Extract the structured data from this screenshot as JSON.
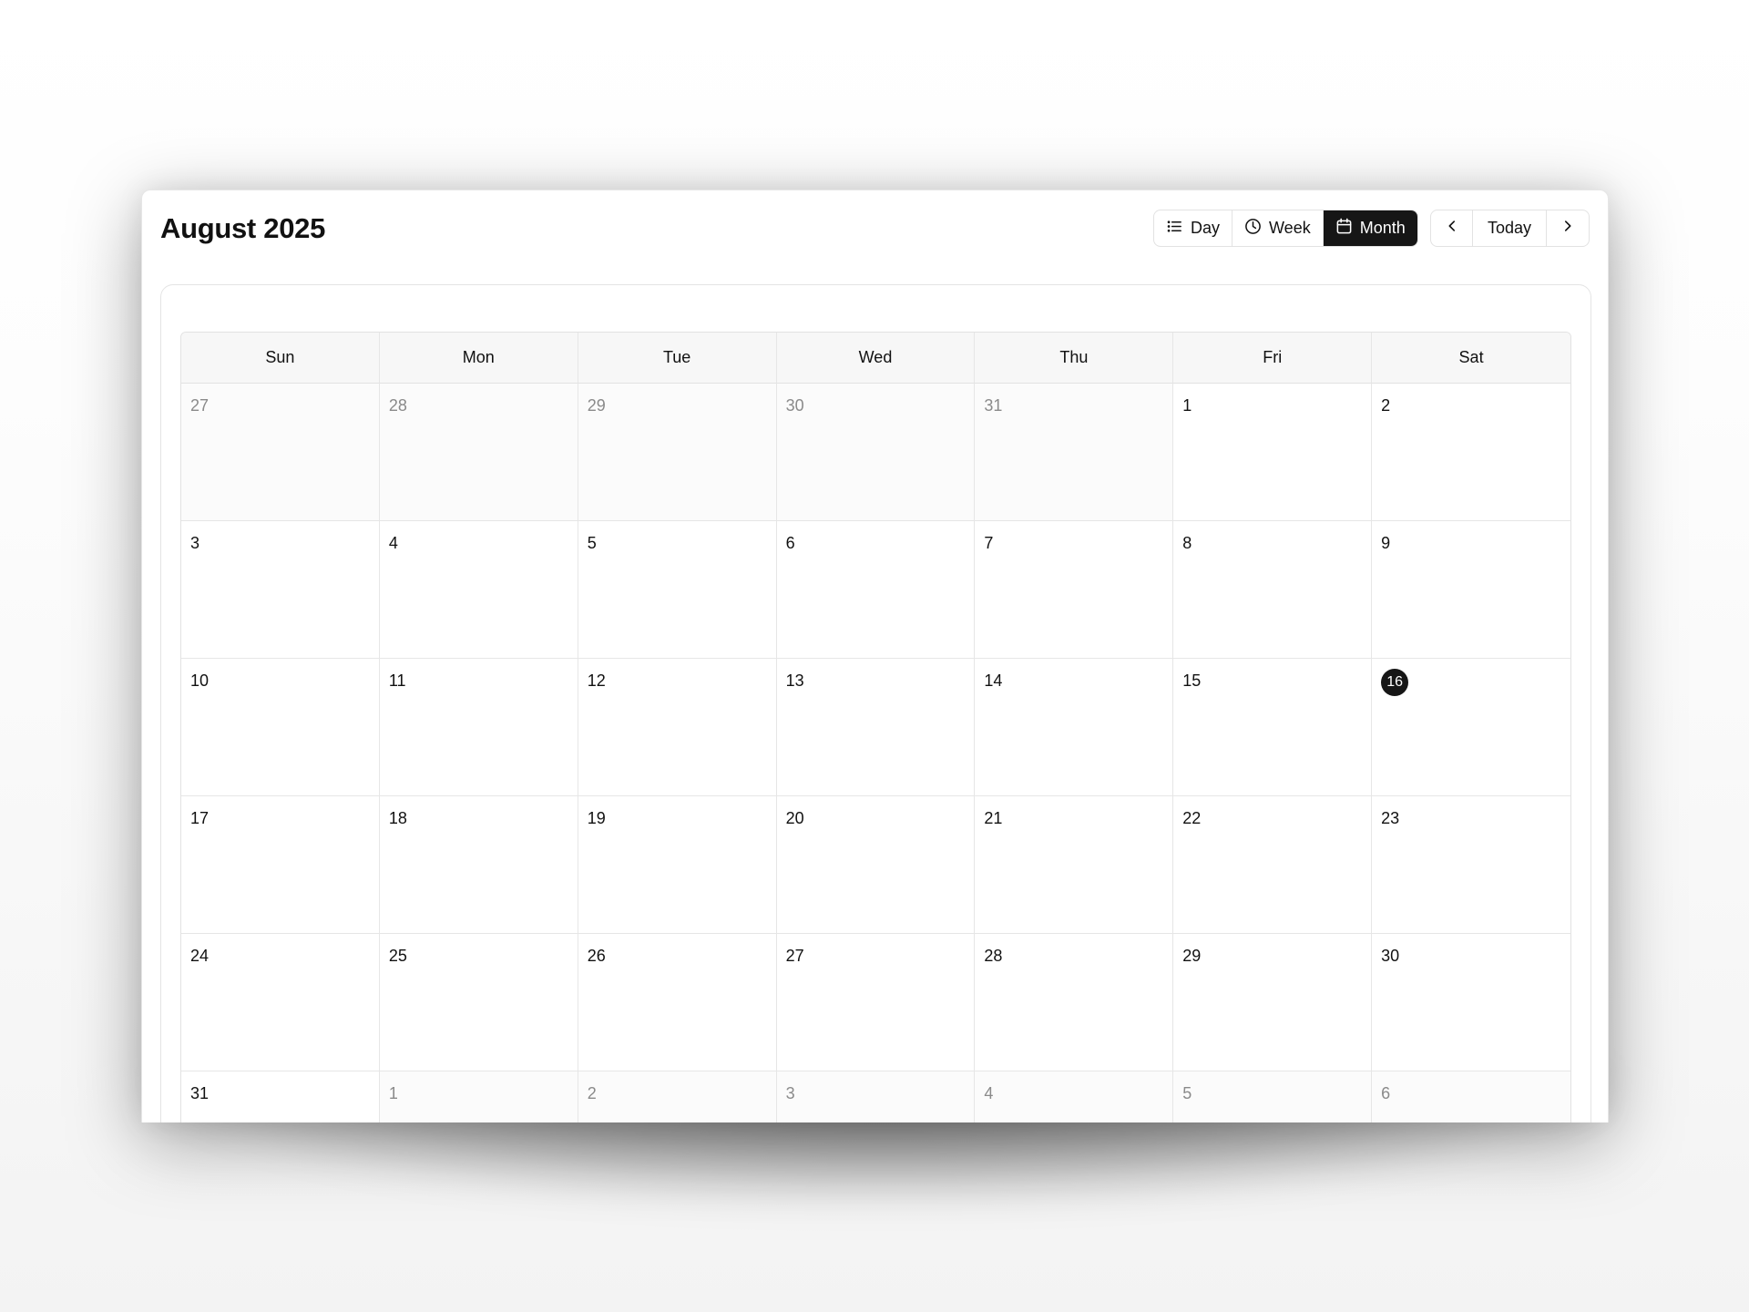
{
  "header": {
    "title": "August 2025",
    "views": [
      {
        "label": "Day",
        "icon": "list-icon",
        "active": false
      },
      {
        "label": "Week",
        "icon": "clock-icon",
        "active": false
      },
      {
        "label": "Month",
        "icon": "calendar-icon",
        "active": true
      }
    ],
    "nav": {
      "prev_icon": "chevron-left-icon",
      "today_label": "Today",
      "next_icon": "chevron-right-icon"
    }
  },
  "calendar": {
    "weekdays": [
      "Sun",
      "Mon",
      "Tue",
      "Wed",
      "Thu",
      "Fri",
      "Sat"
    ],
    "today": 16,
    "weeks": [
      [
        {
          "day": "27",
          "outside": true
        },
        {
          "day": "28",
          "outside": true
        },
        {
          "day": "29",
          "outside": true
        },
        {
          "day": "30",
          "outside": true
        },
        {
          "day": "31",
          "outside": true
        },
        {
          "day": "1",
          "outside": false
        },
        {
          "day": "2",
          "outside": false
        }
      ],
      [
        {
          "day": "3",
          "outside": false
        },
        {
          "day": "4",
          "outside": false
        },
        {
          "day": "5",
          "outside": false
        },
        {
          "day": "6",
          "outside": false
        },
        {
          "day": "7",
          "outside": false
        },
        {
          "day": "8",
          "outside": false
        },
        {
          "day": "9",
          "outside": false
        }
      ],
      [
        {
          "day": "10",
          "outside": false
        },
        {
          "day": "11",
          "outside": false
        },
        {
          "day": "12",
          "outside": false
        },
        {
          "day": "13",
          "outside": false
        },
        {
          "day": "14",
          "outside": false
        },
        {
          "day": "15",
          "outside": false
        },
        {
          "day": "16",
          "outside": false,
          "today": true
        }
      ],
      [
        {
          "day": "17",
          "outside": false
        },
        {
          "day": "18",
          "outside": false
        },
        {
          "day": "19",
          "outside": false
        },
        {
          "day": "20",
          "outside": false
        },
        {
          "day": "21",
          "outside": false
        },
        {
          "day": "22",
          "outside": false
        },
        {
          "day": "23",
          "outside": false
        }
      ],
      [
        {
          "day": "24",
          "outside": false
        },
        {
          "day": "25",
          "outside": false
        },
        {
          "day": "26",
          "outside": false
        },
        {
          "day": "27",
          "outside": false
        },
        {
          "day": "28",
          "outside": false
        },
        {
          "day": "29",
          "outside": false
        },
        {
          "day": "30",
          "outside": false
        }
      ],
      [
        {
          "day": "31",
          "outside": false
        },
        {
          "day": "1",
          "outside": true
        },
        {
          "day": "2",
          "outside": true
        },
        {
          "day": "3",
          "outside": true
        },
        {
          "day": "4",
          "outside": true
        },
        {
          "day": "5",
          "outside": true
        },
        {
          "day": "6",
          "outside": true
        }
      ]
    ]
  },
  "colors": {
    "accent": "#161616",
    "border": "#e2e2e2",
    "header_bg": "#f7f7f7",
    "muted_text": "#8a8a8a"
  }
}
